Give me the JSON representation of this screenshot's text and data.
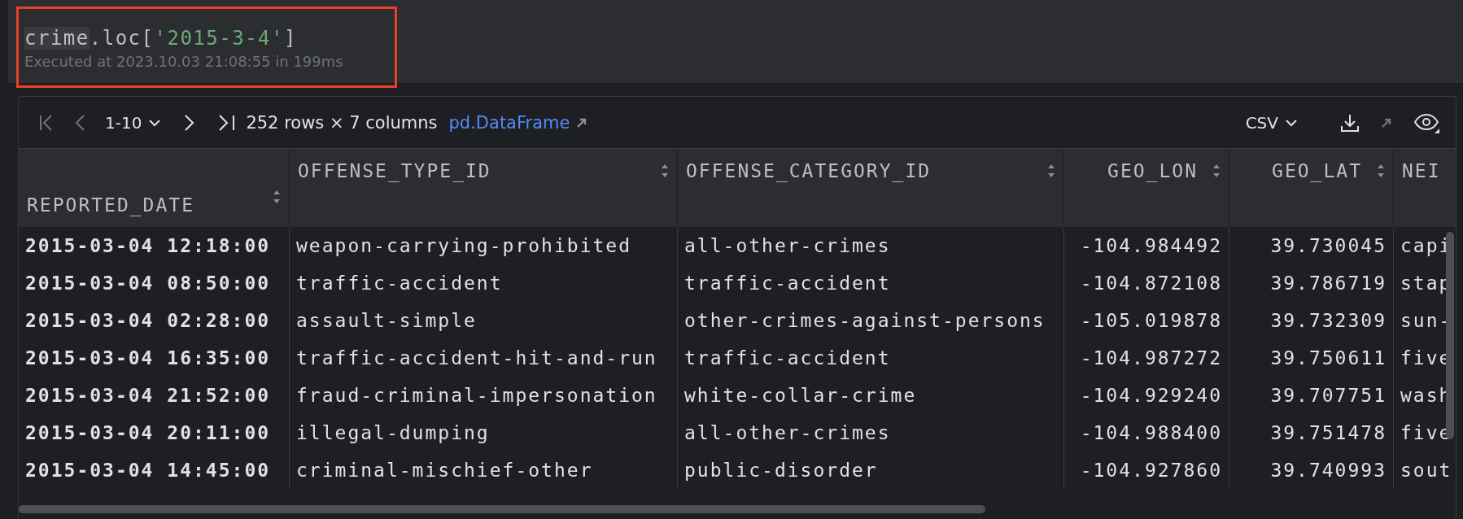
{
  "cell": {
    "code": [
      {
        "kind": "highlight",
        "text": "crime"
      },
      {
        "kind": "plain",
        "text": ".loc["
      },
      {
        "kind": "string",
        "text": "'2015-3-4'"
      },
      {
        "kind": "plain",
        "text": "]"
      }
    ],
    "status": "Executed at 2023.10.03 21:08:55 in 199ms"
  },
  "toolbar": {
    "page_range": "1-10",
    "summary": "252 rows × 7 columns",
    "type_link": "pd.DataFrame",
    "format": "CSV"
  },
  "table": {
    "index_column": "REPORTED_DATE",
    "columns": [
      {
        "label": "OFFENSE_TYPE_ID",
        "kind": "text"
      },
      {
        "label": "OFFENSE_CATEGORY_ID",
        "kind": "text"
      },
      {
        "label": "GEO_LON",
        "kind": "number"
      },
      {
        "label": "GEO_LAT",
        "kind": "number"
      },
      {
        "label": "NEI",
        "kind": "text"
      }
    ],
    "rows": [
      {
        "index": "2015-03-04 12:18:00",
        "cells": [
          "weapon-carrying-prohibited",
          "all-other-crimes",
          "-104.984492",
          "39.730045",
          "capi"
        ]
      },
      {
        "index": "2015-03-04 08:50:00",
        "cells": [
          "traffic-accident",
          "traffic-accident",
          "-104.872108",
          "39.786719",
          "stap"
        ]
      },
      {
        "index": "2015-03-04 02:28:00",
        "cells": [
          "assault-simple",
          "other-crimes-against-persons",
          "-105.019878",
          "39.732309",
          "sun-"
        ]
      },
      {
        "index": "2015-03-04 16:35:00",
        "cells": [
          "traffic-accident-hit-and-run",
          "traffic-accident",
          "-104.987272",
          "39.750611",
          "five"
        ]
      },
      {
        "index": "2015-03-04 21:52:00",
        "cells": [
          "fraud-criminal-impersonation",
          "white-collar-crime",
          "-104.929240",
          "39.707751",
          "wash"
        ]
      },
      {
        "index": "2015-03-04 20:11:00",
        "cells": [
          "illegal-dumping",
          "all-other-crimes",
          "-104.988400",
          "39.751478",
          "five"
        ]
      },
      {
        "index": "2015-03-04 14:45:00",
        "cells": [
          "criminal-mischief-other",
          "public-disorder",
          "-104.927860",
          "39.740993",
          "sout"
        ]
      }
    ]
  }
}
